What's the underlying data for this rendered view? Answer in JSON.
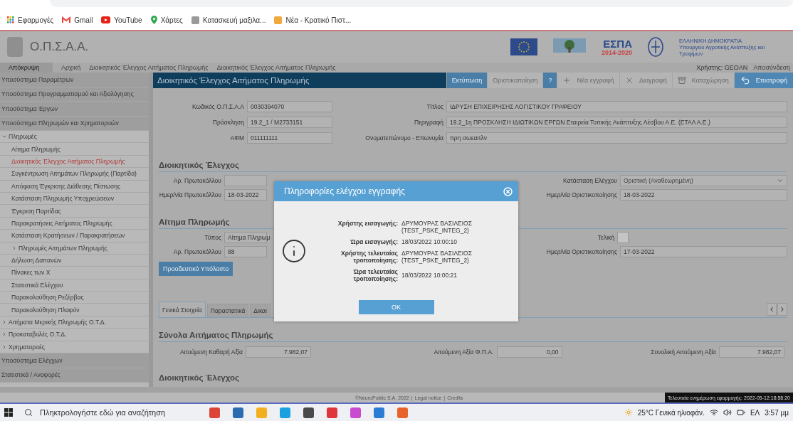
{
  "bookmarks": [
    {
      "label": "Εφαρμογές",
      "kind": "apps"
    },
    {
      "label": "Gmail",
      "kind": "mail"
    },
    {
      "label": "YouTube",
      "kind": "video"
    },
    {
      "label": "Χάρτες",
      "kind": "maps"
    },
    {
      "label": "Κατασκευή μαξιλα...",
      "kind": "cart"
    },
    {
      "label": "Νέα - Κρατικό Πιστ...",
      "kind": "news"
    }
  ],
  "header": {
    "title": "Ο.Π.Σ.Α.Α.",
    "espa": "ΕΣΠΑ",
    "espa_years": "2014-2020",
    "ministry": [
      "ΕΛΛΗΝΙΚΗ ΔΗΜΟΚΡΑΤΙΑ",
      "Υπουργείο Αγροτικής Ανάπτυξης και Τροφίμων"
    ]
  },
  "nav": {
    "toggle": "Απόκρυψη",
    "breadcrumbs": [
      "Αρχική",
      "Διοικητικός Έλεγχος Αιτήματος Πληρωμής",
      "Διοικητικός Έλεγχος Αιτήματος Πληρωμής"
    ],
    "user": "Χρήστης: GEOAN",
    "logout": "Αποσύνδεση"
  },
  "sidebar": {
    "items": [
      {
        "label": "Υποσύστημα Παραμέτρων"
      },
      {
        "label": "Υποσύστημα Προγραμματισμού και Αξιολόγησης"
      },
      {
        "label": "Υποσύστημα Έργων"
      },
      {
        "label": "Υποσύστημα Πληρωμών και Χρηματοροών",
        "children": [
          {
            "label": "Πληρωμές",
            "expanded": true,
            "children": [
              {
                "label": "Αίτημα Πληρωμής",
                "selected": false
              },
              {
                "label": "Διοικητικός Έλεγχος Αιτήματος Πληρωμής",
                "selected": true
              },
              {
                "label": "Συγκέντρωση Αιτημάτων Πληρωμής (Παρτίδα)",
                "selected": false
              },
              {
                "label": "Απόφαση Έγκρισης Διάθεσης Πίστωσης",
                "selected": false
              },
              {
                "label": "Κατάσταση Πληρωμής Υποχρεώσεων",
                "selected": false
              },
              {
                "label": "Έγκριση Παρτίδας",
                "selected": false
              },
              {
                "label": "Παρακρατήσεις Αιτήματος Πληρωμής",
                "selected": false
              },
              {
                "label": "Κατάσταση Κρατήσεων / Παρακρατήσεων",
                "selected": false
              },
              {
                "label": "Πληρωμές Αιτημάτων Πληρωμής",
                "expanded": false
              },
              {
                "label": "Δήλωση Δαπανών",
                "selected": false
              },
              {
                "label": "Πίνακες των Χ",
                "selected": false
              },
              {
                "label": "Στατιστικά Ελέγχου",
                "selected": false
              },
              {
                "label": "Παρακολούθηση Ρεζέρβας",
                "selected": false
              },
              {
                "label": "Παρακολούθηση Πλαφόν",
                "selected": false
              }
            ]
          },
          {
            "label": "Αιτήματα Μερικής Πληρωμής Ο.Τ.Δ.",
            "expanded": false
          },
          {
            "label": "Προκαταβολές Ο.Τ.Δ.",
            "expanded": false
          },
          {
            "label": "Χρηματοροές",
            "expanded": false
          }
        ]
      },
      {
        "label": "Υποσύστημα Ελέγχων"
      },
      {
        "label": "Στατιστικά / Αναφορές"
      }
    ]
  },
  "page": {
    "title": "Διοικητικός Έλεγχος Αιτήματος Πληρωμής",
    "toolbar": [
      {
        "label": "Εκτύπωση",
        "kind": "text",
        "disabled": false
      },
      {
        "label": "Οριστικοποίηση",
        "kind": "text",
        "disabled": true
      },
      {
        "label": "?",
        "kind": "text",
        "disabled": false
      },
      {
        "label": "Νέα εγγραφή",
        "kind": "add",
        "disabled": true
      },
      {
        "label": "Διαγραφή",
        "kind": "delete",
        "disabled": true
      },
      {
        "label": "Καταχώρηση",
        "kind": "save",
        "disabled": true
      },
      {
        "label": "Επιστροφή",
        "kind": "back",
        "disabled": false
      }
    ],
    "summary": [
      {
        "left": {
          "label": "Κωδικός Ο.Π.Σ.Α.Α",
          "value": "0030394070"
        },
        "right": {
          "label": "Τίτλος",
          "value": "ΙΔΡΥΣΗ ΕΠΙΧΕΙΡΗΣΗΣ ΛΟΓΙΣΤΙΚΟΥ ΓΡΑΦΕΙΟΥ"
        }
      },
      {
        "left": {
          "label": "Πρόσκληση",
          "value": "19.2_1 / M2733151"
        },
        "right": {
          "label": "Περιγραφή",
          "value": "19.2_1η ΠΡΟΣΚΛΗΣΗ ΙΔΙΩΤΙΚΩΝ ΕΡΓΩΝ Εταιρεία Τοπικής Ανάπτυξης Λέσβου Α.Ε. (ΕΤΑΛ Α.Ε.)"
        }
      },
      {
        "left": {
          "label": "ΑΦΜ",
          "value": "011111111"
        },
        "right": {
          "label": "Ονοματεπώνυμο - Επωνυμία",
          "value": "πρη σωεαιτλν"
        }
      }
    ],
    "control": {
      "heading": "Διοικητικός Έλεγχος",
      "rows": [
        {
          "left": {
            "label": "Αρ. Πρωτοκόλλου"
          },
          "right": {
            "label": "Κατάσταση Ελέγχου",
            "value": "Οριστική (Αναθεωρημένη)",
            "kind": "select"
          }
        },
        {
          "left": {
            "label": "Ημερ/νία Πρωτοκόλλου",
            "value": "18-03-2022"
          },
          "right": {
            "label": "Ημερ/νία Οριστικοποίησης",
            "value": "18-03-2022",
            "kind": "text"
          }
        }
      ]
    },
    "request": {
      "heading": "Αίτημα Πληρωμής",
      "rows": [
        {
          "left": {
            "label": "Τύπος",
            "value": "Αίτημα Πληρωμ"
          },
          "right": {
            "label": "Τελική",
            "kind": "checkbox",
            "checked": false
          }
        },
        {
          "left": {
            "label": "Αρ. Πρωτοκόλλου",
            "value": "88"
          },
          "right": {
            "label": "Ημερ/νία Οριστικοποίησης",
            "value": "17-03-2022",
            "kind": "text"
          }
        }
      ],
      "button": "Προοδευτικό Υπόλοιπο"
    },
    "tabs": [
      {
        "label": "Γενικά Στοιχεία",
        "selected": true
      },
      {
        "label": "Παραστατικά",
        "selected": false
      },
      {
        "label": "Δικαι",
        "selected": false
      }
    ],
    "totals": {
      "heading": "Σύνολα Αιτήματος Πληρωμής",
      "fields": [
        {
          "label": "Αιτούμενη Καθαρή Αξία",
          "value": "7.982,07"
        },
        {
          "label": "Αιτούμενη Αξία Φ.Π.Α.",
          "value": "0,00"
        },
        {
          "label": "Συνολική Αιτούμενη Αξία",
          "value": "7.982,07"
        }
      ]
    },
    "next_heading": "Διοικητικός Έλεγχος"
  },
  "dialog": {
    "title": "Πληροφορίες ελέγχου εγγραφής",
    "rows": [
      {
        "label": "Χρήστης εισαγωγής:",
        "value": "ΔΡΥΜΟΥΡΑΣ ΒΑΣΙΛΕΙΟΣ (TEST_PSKE_INTEG_2)"
      },
      {
        "label": "Ώρα εισαγωγής:",
        "value": "18/03/2022 10:00:10"
      },
      {
        "label": "Χρήστης τελευταίας τροποποίησης:",
        "value": "ΔΡΥΜΟΥΡΑΣ ΒΑΣΙΛΕΙΟΣ (TEST_PSKE_INTEG_2)"
      },
      {
        "label": "Ώρα τελευταίας τροποποίησης:",
        "value": "18/03/2022 10:00:21"
      }
    ],
    "button": "OK"
  },
  "footer": {
    "copyright": "©NeuroPublic S.A. 2022",
    "separator": "|",
    "links": [
      "Legal notice",
      "Credits"
    ],
    "last_update": "Τελευταία ενημέρωση εφαρμογής: 2022-05-12:18:58:20"
  },
  "taskbar": {
    "search_placeholder": "Πληκτρολογήστε εδώ για αναζήτηση",
    "apps": [
      {
        "color": "#db4437"
      },
      {
        "color": "#2b6cb0"
      },
      {
        "color": "#f2b01e"
      },
      {
        "color": "#1aa1e0"
      },
      {
        "color": "#4a4a4a"
      },
      {
        "color": "#e0353b"
      },
      {
        "color": "#c94bd0"
      },
      {
        "color": "#2b7cd3"
      },
      {
        "color": "#e8632b"
      }
    ],
    "weather": "25°C Γενικά ηλιοφάν.",
    "language": "ΕΛ",
    "time": "3:57 μμ"
  }
}
